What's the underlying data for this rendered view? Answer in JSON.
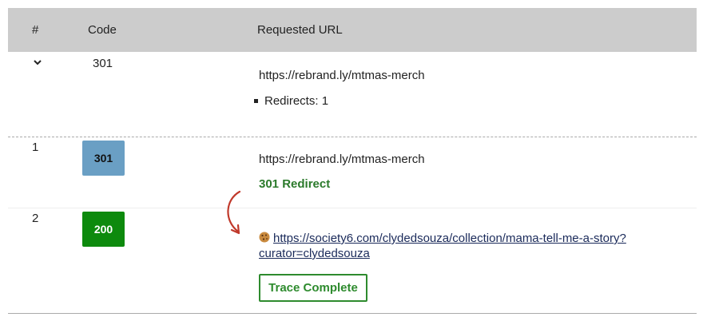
{
  "header": {
    "num_label": "#",
    "code_label": "Code",
    "url_label": "Requested URL"
  },
  "summary": {
    "code": "301",
    "url": "https://rebrand.ly/mtmas-merch",
    "redirects_text": "Redirects: 1"
  },
  "hops": [
    {
      "num": "1",
      "code": "301",
      "code_color": "#6a9fc4",
      "url": "https://rebrand.ly/mtmas-merch",
      "status_text": "301 Redirect"
    },
    {
      "num": "2",
      "code": "200",
      "code_color": "#0d8a0d",
      "icon": "cookie-icon",
      "url": "https://society6.com/clydedsouza/collection/mama-tell-me-a-story?curator=clydedsouza",
      "status_text": "Trace Complete"
    }
  ],
  "colors": {
    "header_bg": "#cccccc",
    "redirect_text": "#2b7a2b",
    "arrow": "#c0392b"
  }
}
